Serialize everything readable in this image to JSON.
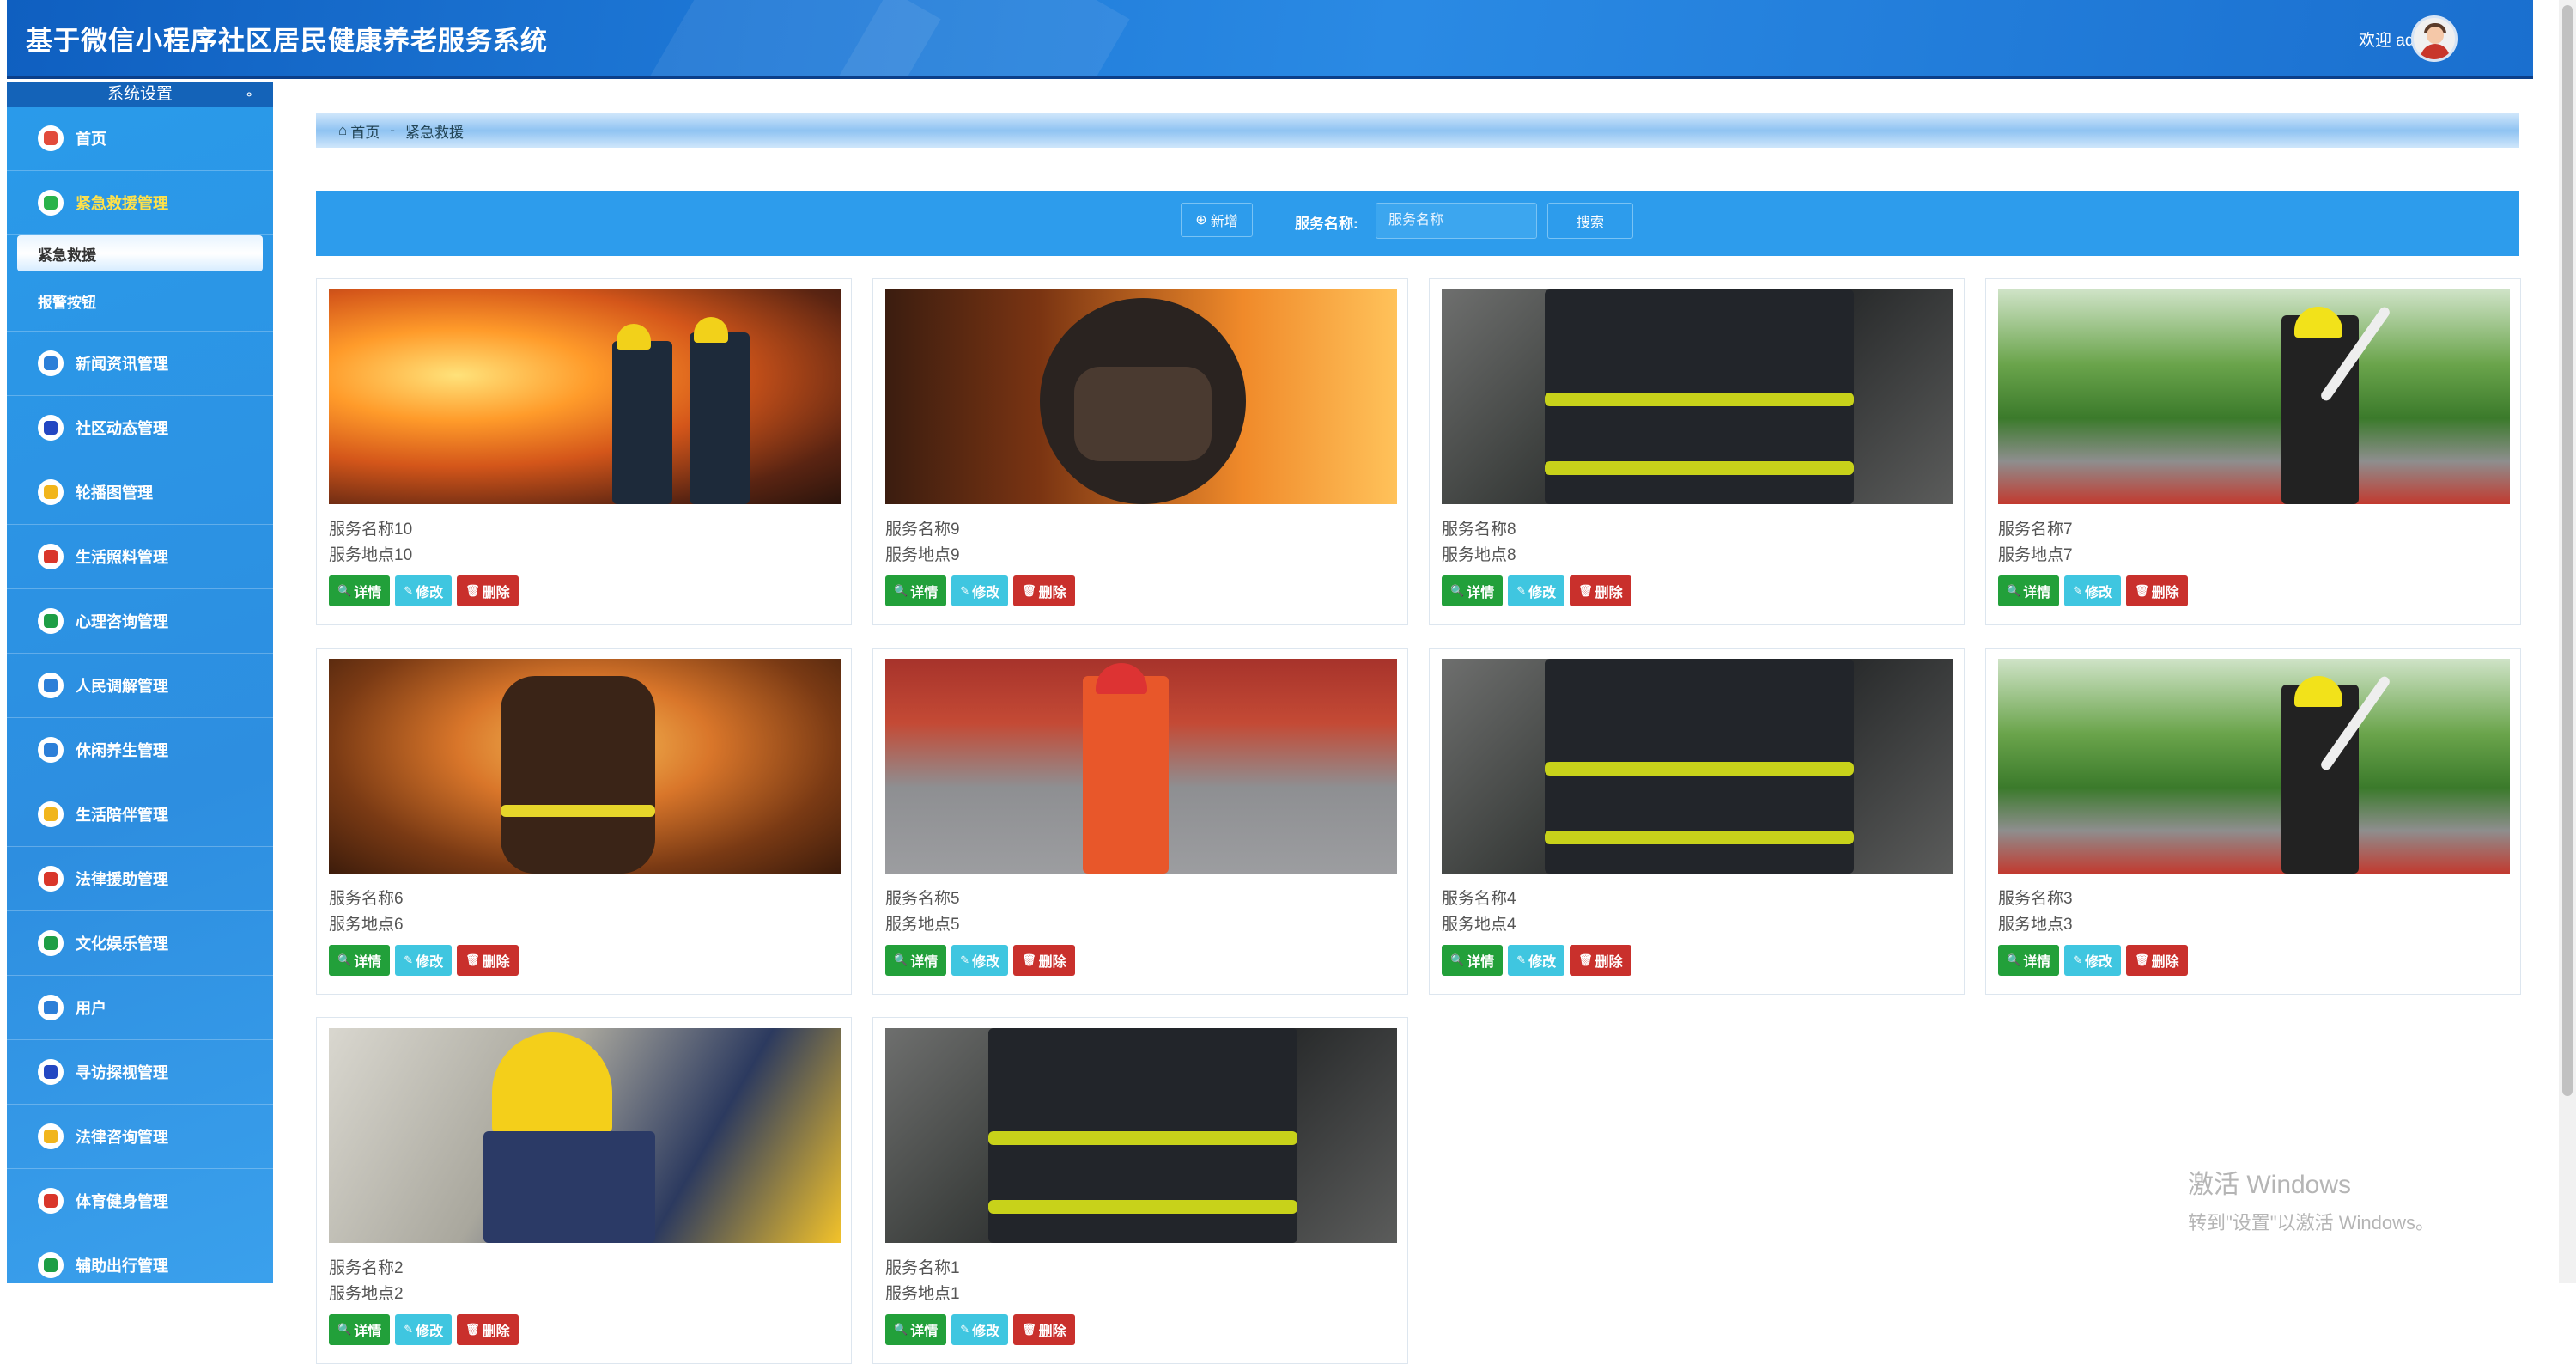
{
  "header": {
    "title": "基于微信小程序社区居民健康养老服务系统",
    "welcome": "欢迎 admin"
  },
  "sidebar": {
    "section_title": "系统设置",
    "items": [
      {
        "label": "首页",
        "icon": "home-icon",
        "color": "#e24b3b"
      },
      {
        "label": "紧急救援管理",
        "icon": "grid-icon",
        "color": "#29b34a",
        "active": true
      },
      {
        "label": "新闻资讯管理",
        "icon": "news-icon",
        "color": "#2c7fd8"
      },
      {
        "label": "社区动态管理",
        "icon": "community-icon",
        "color": "#2347c2"
      },
      {
        "label": "轮播图管理",
        "icon": "carousel-icon",
        "color": "#f1b51c"
      },
      {
        "label": "生活照料管理",
        "icon": "care-icon",
        "color": "#d9362a"
      },
      {
        "label": "心理咨询管理",
        "icon": "heart-icon",
        "color": "#1e9e45"
      },
      {
        "label": "人民调解管理",
        "icon": "mediation-icon",
        "color": "#2c7fd8"
      },
      {
        "label": "休闲养生管理",
        "icon": "leisure-icon",
        "color": "#2c7fd8"
      },
      {
        "label": "生活陪伴管理",
        "icon": "companion-icon",
        "color": "#f1b51c"
      },
      {
        "label": "法律援助管理",
        "icon": "legal-icon",
        "color": "#d9362a"
      },
      {
        "label": "文化娱乐管理",
        "icon": "culture-icon",
        "color": "#1e9e45"
      },
      {
        "label": "用户",
        "icon": "user-icon",
        "color": "#2c7fd8"
      },
      {
        "label": "寻访探视管理",
        "icon": "visit-icon",
        "color": "#2347c2"
      },
      {
        "label": "法律咨询管理",
        "icon": "consult-icon",
        "color": "#f1b51c"
      },
      {
        "label": "体育健身管理",
        "icon": "fitness-icon",
        "color": "#d9362a"
      },
      {
        "label": "辅助出行管理",
        "icon": "travel-icon",
        "color": "#1e9e45"
      }
    ],
    "sub_items": [
      "紧急救援",
      "报警按钮"
    ]
  },
  "breadcrumb": {
    "home": "首页",
    "sep": "-",
    "current": "紧急救援"
  },
  "toolbar": {
    "add_label": "新增",
    "search_label": "服务名称:",
    "search_placeholder": "服务名称",
    "search_button": "搜索"
  },
  "actions": {
    "detail": "详情",
    "edit": "修改",
    "delete": "删除"
  },
  "cards": [
    {
      "name": "服务名称10",
      "place": "服务地点10",
      "scene": "fire"
    },
    {
      "name": "服务名称9",
      "place": "服务地点9",
      "scene": "helmet"
    },
    {
      "name": "服务名称8",
      "place": "服务地点8",
      "scene": "jacket"
    },
    {
      "name": "服务名称7",
      "place": "服务地点7",
      "scene": "hose"
    },
    {
      "name": "服务名称6",
      "place": "服务地点6",
      "scene": "smoke"
    },
    {
      "name": "服务名称5",
      "place": "服务地点5",
      "scene": "drill"
    },
    {
      "name": "服务名称4",
      "place": "服务地点4",
      "scene": "jacket"
    },
    {
      "name": "服务名称3",
      "place": "服务地点3",
      "scene": "hose"
    },
    {
      "name": "服务名称2",
      "place": "服务地点2",
      "scene": "rescue"
    },
    {
      "name": "服务名称1",
      "place": "服务地点1",
      "scene": "jacket"
    }
  ],
  "watermark": {
    "line1": "激活 Windows",
    "line2": "转到\"设置\"以激活 Windows。"
  }
}
